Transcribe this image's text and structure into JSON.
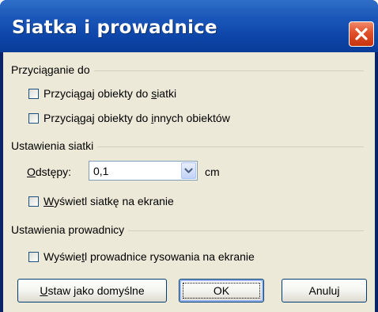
{
  "window": {
    "title": "Siatka i prowadnice"
  },
  "snap_group": {
    "label": "Przyciąganie do",
    "snap_to_grid": {
      "pre": "Przyciągaj obiekty do ",
      "key": "s",
      "post": "iatki",
      "checked": false
    },
    "snap_to_objects": {
      "pre": "Przyciągaj obiekty do ",
      "key": "i",
      "post": "nnych obiektów",
      "checked": false
    }
  },
  "grid_group": {
    "label": "Ustawienia siatki",
    "spacing": {
      "key": "O",
      "rest": "dstępy:",
      "value": "0,1",
      "unit": "cm"
    },
    "display_grid": {
      "pre": "",
      "key": "W",
      "post": "yświetl siatkę na ekranie",
      "checked": false
    }
  },
  "guides_group": {
    "label": "Ustawienia prowadnicy",
    "display_guides": {
      "pre": "Wyświe",
      "key": "t",
      "post": "l prowadnice rysowania na ekranie",
      "checked": false
    }
  },
  "buttons": {
    "set_default": {
      "key": "U",
      "rest": "staw jako domyślne"
    },
    "ok": "OK",
    "cancel": "Anuluj"
  },
  "colors": {
    "titlebar": "#0a3c98",
    "dialog_bg": "#ece9d8",
    "close_button": "#e0502a"
  }
}
